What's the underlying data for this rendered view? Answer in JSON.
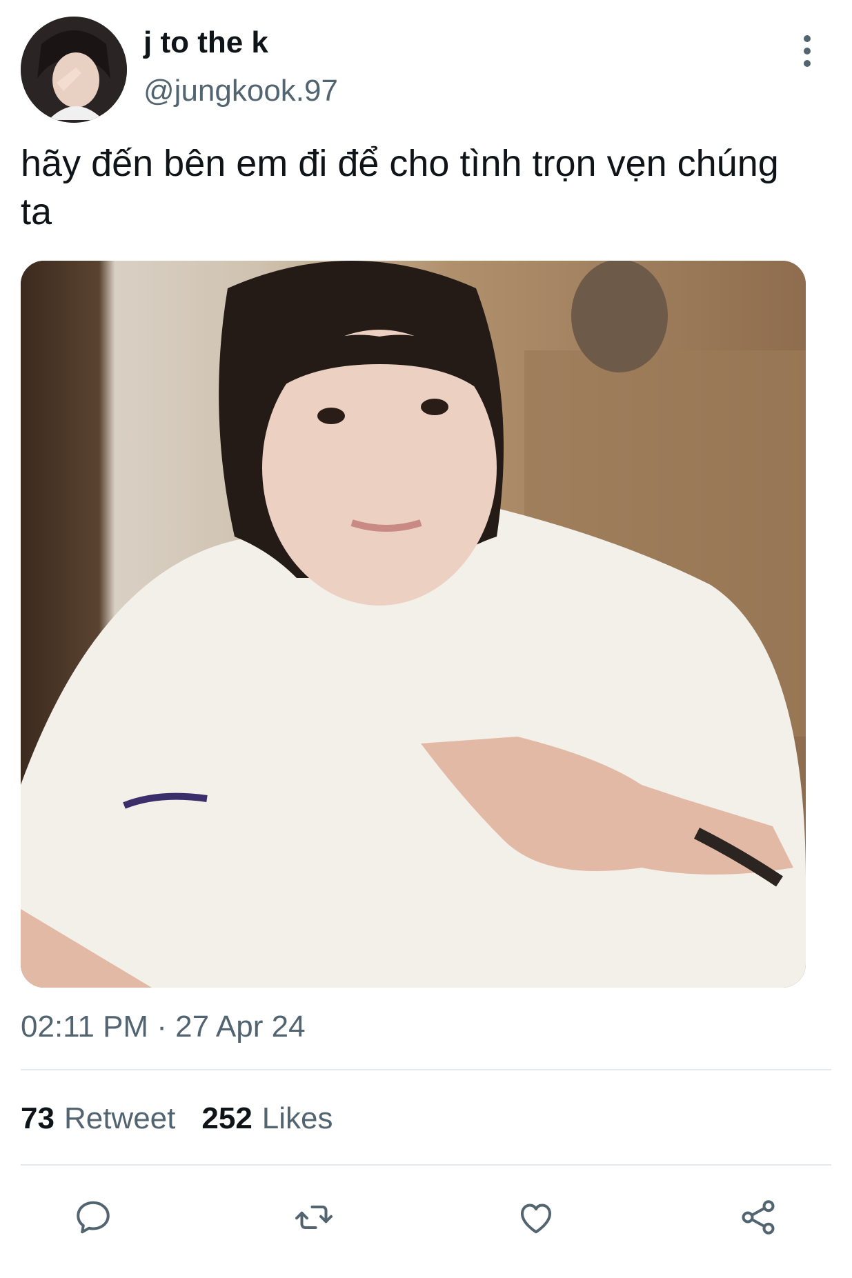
{
  "author": {
    "display_name": "j to the k",
    "handle": "@jungkook.97"
  },
  "tweet": {
    "text": "hãy đến bên em đi để cho tình trọn vẹn chúng ta",
    "timestamp": "02:11 PM · 27 Apr 24"
  },
  "stats": {
    "retweets": {
      "count": "73",
      "label": "Retweet"
    },
    "likes": {
      "count": "252",
      "label": "Likes"
    }
  },
  "icons": {
    "more": "more-vertical-icon",
    "reply": "reply-icon",
    "retweet": "retweet-icon",
    "like": "heart-icon",
    "share": "share-icon"
  },
  "colors": {
    "text_primary": "#0f1419",
    "text_secondary": "#536471",
    "divider": "#e6e9ec"
  }
}
